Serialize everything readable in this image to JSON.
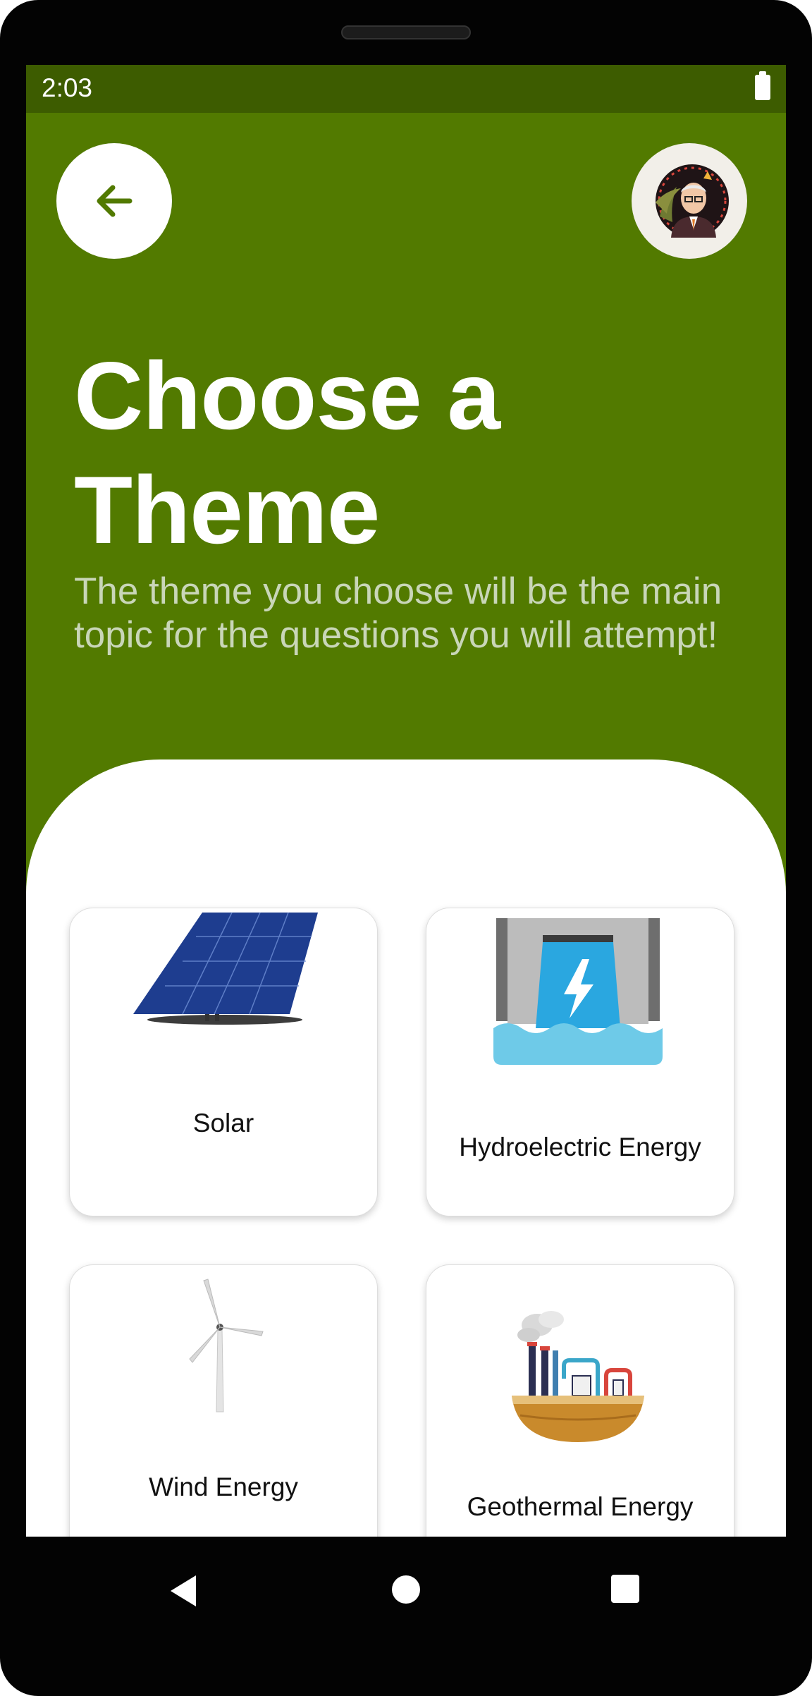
{
  "status_bar": {
    "time": "2:03"
  },
  "header": {
    "title_line1": "Choose a",
    "title_line2": "Theme",
    "subtitle": "The theme you choose will be the main topic for the questions you will attempt!"
  },
  "themes": [
    {
      "label": "Solar",
      "icon": "solar-panel-icon"
    },
    {
      "label": "Hydroelectric Energy",
      "icon": "hydroelectric-dam-icon"
    },
    {
      "label": "Wind Energy",
      "icon": "wind-turbine-icon"
    },
    {
      "label": "Geothermal Energy",
      "icon": "geothermal-plant-icon"
    }
  ],
  "colors": {
    "primary_green": "#527a00",
    "status_bar_green": "#3d5c00",
    "subtitle_text": "#c9d6b8",
    "card_background": "#ffffff"
  }
}
